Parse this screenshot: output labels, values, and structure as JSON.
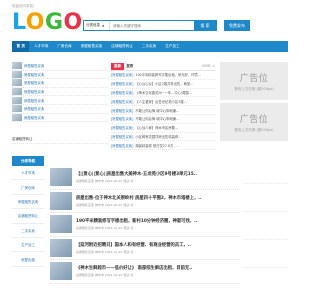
{
  "header": {
    "welcome": "欢迎访问本站！",
    "logo": [
      "L",
      "O",
      "G",
      "O"
    ],
    "search": {
      "category": "分类信息",
      "placeholder": "请输入关键字搜索",
      "button": "搜 索"
    },
    "post_button": "免费发布"
  },
  "nav": {
    "items": [
      {
        "label": "首 页",
        "active": true
      },
      {
        "label": "人才市场",
        "active": false
      },
      {
        "label": "厂房仓库",
        "active": false
      },
      {
        "label": "房屋租售买卖",
        "active": false
      },
      {
        "label": "店铺租赁转让",
        "active": false
      },
      {
        "label": "二手买卖",
        "active": false
      },
      {
        "label": "生产加工",
        "active": false
      }
    ]
  },
  "left_list": {
    "items": [
      "房屋租售买卖",
      "房屋租售买卖",
      "房屋租售买卖",
      "房屋租售买卖",
      "房屋租售买卖",
      "房屋租售买卖",
      "房屋租售买卖"
    ]
  },
  "hot_list": {
    "items": [
      "店铺租赁转让",
      "二手买卖",
      "生产加工"
    ]
  },
  "news": {
    "tag_red": "最新",
    "tag": "发布",
    "more": "MORE >",
    "rows": [
      {
        "cat": "[房屋租售买卖]",
        "title": "190平米精装修写字楼出租，采光好，环境..."
      },
      {
        "cat": "[房屋租售买卖]",
        "title": "【心仪心仪】小区2楼共享出售，两室..."
      },
      {
        "cat": "[房屋租售买卖]",
        "title": "《神木文化路苏州~一车…中心/周围..."
      },
      {
        "cat": "[房屋租售买卖]",
        "title": "【人生爱家】出售世纪苑小区3楼..."
      },
      {
        "cat": "[房屋租售买卖]",
        "title": "不敢让你后悔 城中心带地铺..."
      },
      {
        "cat": "[房屋租售买卖]",
        "title": "不敢让你后悔 城中心带地铺..."
      },
      {
        "cat": "[房屋租售买卖]",
        "title": "【心仙人家】神木市区房屋..."
      },
      {
        "cat": "[房屋租售买卖]",
        "title": "小区稀有花园洋房出售精装修..."
      },
      {
        "cat": "[房屋租售买卖]",
        "title": "湖景精装修 首付仅27.8万 ..."
      }
    ]
  },
  "ads": {
    "right_top": {
      "title": "广告位",
      "size": "首页上方右侧 (宽200px)"
    },
    "right_mid": {
      "title": "广告位",
      "size": "首页上方右侧 (宽200px)"
    }
  },
  "side": {
    "head": "分类导航",
    "items": [
      "人才市场",
      "厂房仓库",
      "房屋租售买卖",
      "店铺租赁转让",
      "二手买卖",
      "生产加工",
      "房屋出租"
    ]
  },
  "feed": [
    {
      "title": "【||爱心||爱心||房屋出售大美神木-五龙苑小区9号楼3单元15..",
      "meta": "房屋租售买卖  神木市  2021-02-25  阅读 次"
    },
    {
      "title": "房屋出售-位于神木北关崇岭村 房屋四十平围2，神木市塔楼上，..",
      "meta": "房屋租售买卖  神木市  2021-02-25  阅读 次"
    },
    {
      "title": "190平米精装修写字楼出租，新村10分钟经济圈，神驱可找，..",
      "meta": "房屋租售买卖  神木市  2021-02-25  阅读 次"
    },
    {
      "title": "【延河附近招聘日】国本人和有经营、有商业经营的员工，..",
      "meta": "房屋租售买卖  神木市  2021-02-25  阅读 次"
    },
    {
      "title": "《神木生鲜超市——低价好让》 南部综生鲜店出租，目前无..",
      "meta": "房屋租售买卖  神木市  2021-02-25  阅读 次"
    }
  ]
}
